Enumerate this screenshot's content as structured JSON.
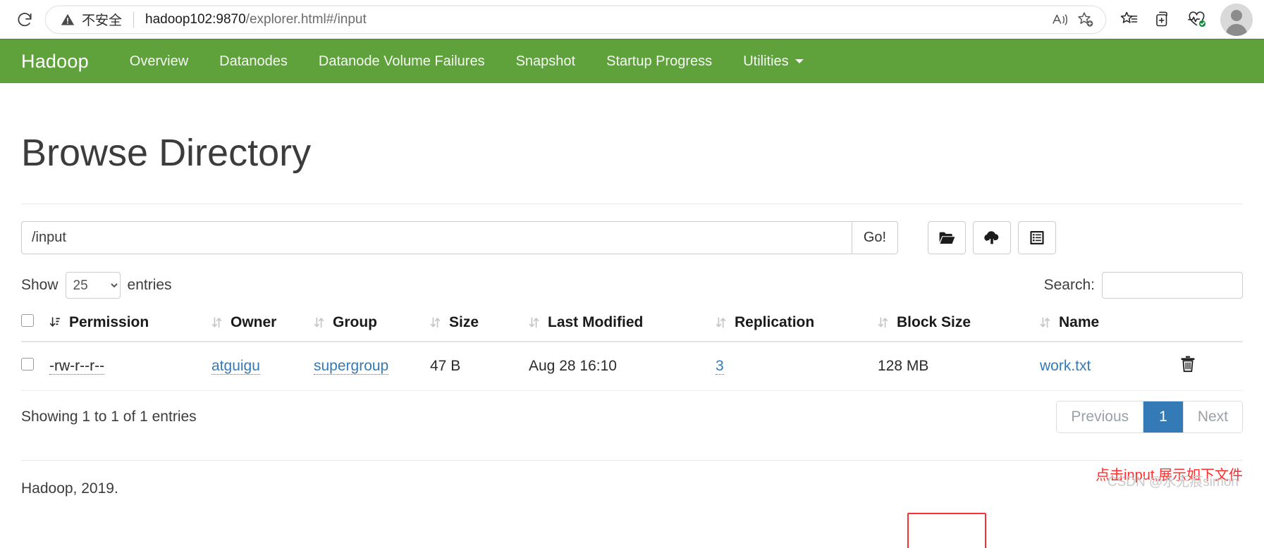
{
  "browser": {
    "reload_icon": "reload-icon",
    "security_label": "不安全",
    "security_icon": "warning-triangle-icon",
    "url_host": "hadoop102:9870",
    "url_path": "/explorer.html#/input",
    "read_aloud_icon": "read-aloud-icon",
    "add_favorite_icon": "add-to-favorites-icon",
    "favorites_icon": "favorites-icon",
    "collections_icon": "collections-icon",
    "browser_essentials_icon": "browser-essentials-icon",
    "profile_icon": "profile-avatar-icon"
  },
  "navbar": {
    "brand": "Hadoop",
    "accent_color": "#5fa23c",
    "links": [
      {
        "label": "Overview"
      },
      {
        "label": "Datanodes"
      },
      {
        "label": "Datanode Volume Failures"
      },
      {
        "label": "Snapshot"
      },
      {
        "label": "Startup Progress"
      }
    ],
    "dropdown": {
      "label": "Utilities",
      "icon": "chevron-down-icon"
    }
  },
  "page": {
    "title": "Browse Directory",
    "footer": "Hadoop, 2019.",
    "watermark": "CSDN @水无痕simon"
  },
  "path_bar": {
    "value": "/input",
    "placeholder": "",
    "go_label": "Go!",
    "buttons": [
      {
        "name": "new-directory-button",
        "icon": "folder-open-icon"
      },
      {
        "name": "upload-files-button",
        "icon": "cloud-upload-icon"
      },
      {
        "name": "snapshot-button",
        "icon": "list-box-icon"
      }
    ]
  },
  "controls": {
    "show_label": "Show",
    "entries_label": "entries",
    "entries_value": "25",
    "entries_options": [
      "25"
    ],
    "search_label": "Search:",
    "search_value": "",
    "search_placeholder": ""
  },
  "annotation": {
    "text": "点击input,展示如下文件",
    "color": "#ff2d2d"
  },
  "table": {
    "columns": [
      "Permission",
      "Owner",
      "Group",
      "Size",
      "Last Modified",
      "Replication",
      "Block Size",
      "Name"
    ],
    "rows": [
      {
        "permission": "-rw-r--r--",
        "owner": "atguigu",
        "group": "supergroup",
        "size": "47 B",
        "last_modified": "Aug 28 16:10",
        "replication": "3",
        "block_size": "128 MB",
        "name": "work.txt",
        "delete_icon": "trash-icon"
      }
    ]
  },
  "table_footer": {
    "showing": "Showing 1 to 1 of 1 entries",
    "pagination": {
      "previous": "Previous",
      "pages": [
        "1"
      ],
      "next": "Next",
      "active": "1",
      "active_color": "#337ab7"
    }
  }
}
